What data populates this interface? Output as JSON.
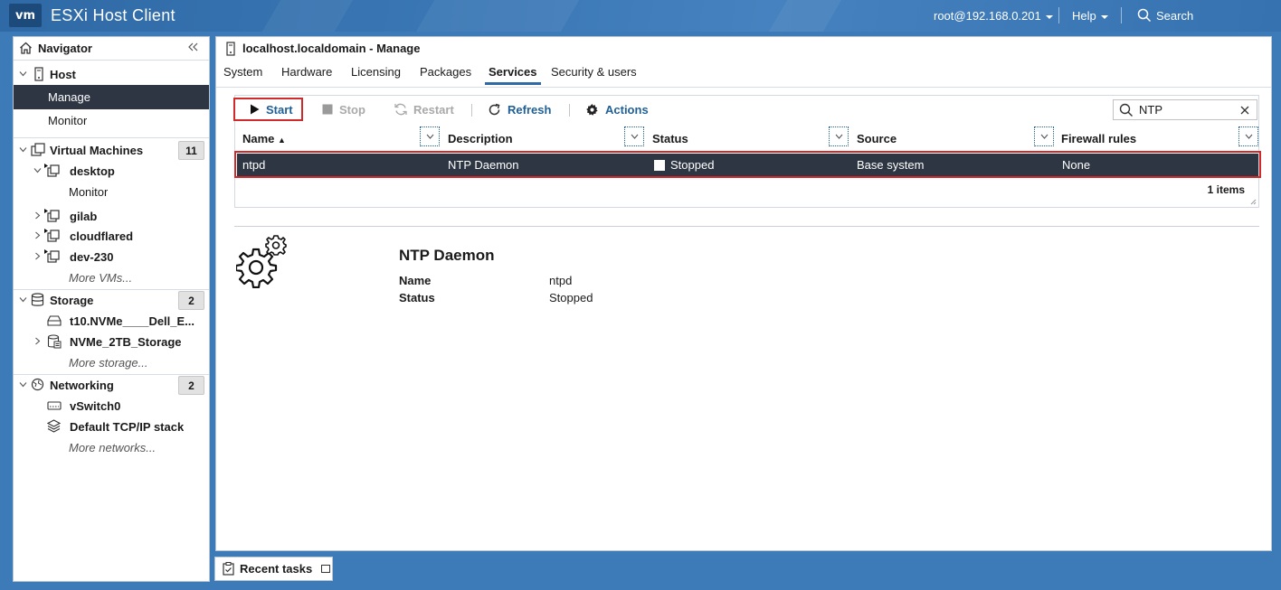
{
  "app": {
    "logo": "vm",
    "title": "ESXi Host Client"
  },
  "topbar": {
    "user": "root@192.168.0.201",
    "help": "Help",
    "search": "Search"
  },
  "navigator": {
    "title": "Navigator",
    "host": {
      "label": "Host",
      "items": [
        "Manage",
        "Monitor"
      ]
    },
    "virtual_machines": {
      "label": "Virtual Machines",
      "count": "11",
      "vms": [
        {
          "name": "desktop",
          "child": "Monitor"
        },
        {
          "name": "gilab"
        },
        {
          "name": "cloudflared"
        },
        {
          "name": "dev-230"
        }
      ],
      "more": "More VMs..."
    },
    "storage": {
      "label": "Storage",
      "count": "2",
      "items": [
        "t10.NVMe____Dell_E...",
        "NVMe_2TB_Storage"
      ],
      "more": "More storage..."
    },
    "networking": {
      "label": "Networking",
      "count": "2",
      "items": [
        "vSwitch0",
        "Default TCP/IP stack"
      ],
      "more": "More networks..."
    }
  },
  "main": {
    "title": "localhost.localdomain - Manage",
    "tabs": [
      "System",
      "Hardware",
      "Licensing",
      "Packages",
      "Services",
      "Security & users"
    ],
    "active_tab": "Services",
    "toolbar": {
      "start": "Start",
      "stop": "Stop",
      "restart": "Restart",
      "refresh": "Refresh",
      "actions": "Actions"
    },
    "search_value": "NTP",
    "columns": [
      "Name",
      "Description",
      "Status",
      "Source",
      "Firewall rules"
    ],
    "sort_indicator": "▲",
    "rows": [
      {
        "name": "ntpd",
        "description": "NTP Daemon",
        "status": "Stopped",
        "source": "Base system",
        "firewall": "None"
      }
    ],
    "items_count": "1 items",
    "detail": {
      "title": "NTP Daemon",
      "fields": [
        {
          "key": "Name",
          "value": "ntpd"
        },
        {
          "key": "Status",
          "value": "Stopped"
        }
      ]
    }
  },
  "footer": {
    "recent_tasks": "Recent tasks"
  },
  "colors": {
    "accent": "#2f6aa6",
    "selected_row": "#2d3642",
    "highlight_outline": "#d02a2a",
    "link_blue": "#1f5f96"
  }
}
